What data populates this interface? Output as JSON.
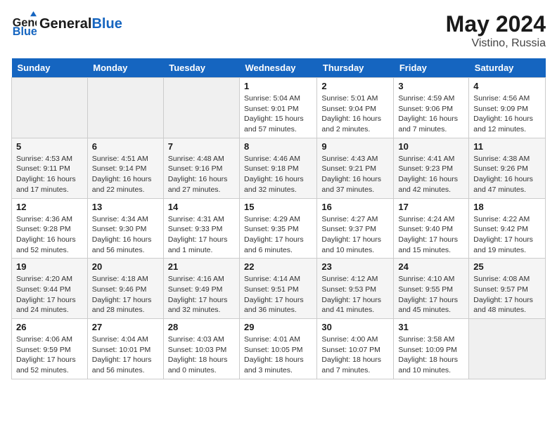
{
  "header": {
    "logo_general": "General",
    "logo_blue": "Blue",
    "month_year": "May 2024",
    "location": "Vistino, Russia"
  },
  "weekdays": [
    "Sunday",
    "Monday",
    "Tuesday",
    "Wednesday",
    "Thursday",
    "Friday",
    "Saturday"
  ],
  "weeks": [
    [
      {
        "day": "",
        "sunrise": "",
        "sunset": "",
        "daylight": ""
      },
      {
        "day": "",
        "sunrise": "",
        "sunset": "",
        "daylight": ""
      },
      {
        "day": "",
        "sunrise": "",
        "sunset": "",
        "daylight": ""
      },
      {
        "day": "1",
        "sunrise": "Sunrise: 5:04 AM",
        "sunset": "Sunset: 9:01 PM",
        "daylight": "Daylight: 15 hours and 57 minutes."
      },
      {
        "day": "2",
        "sunrise": "Sunrise: 5:01 AM",
        "sunset": "Sunset: 9:04 PM",
        "daylight": "Daylight: 16 hours and 2 minutes."
      },
      {
        "day": "3",
        "sunrise": "Sunrise: 4:59 AM",
        "sunset": "Sunset: 9:06 PM",
        "daylight": "Daylight: 16 hours and 7 minutes."
      },
      {
        "day": "4",
        "sunrise": "Sunrise: 4:56 AM",
        "sunset": "Sunset: 9:09 PM",
        "daylight": "Daylight: 16 hours and 12 minutes."
      }
    ],
    [
      {
        "day": "5",
        "sunrise": "Sunrise: 4:53 AM",
        "sunset": "Sunset: 9:11 PM",
        "daylight": "Daylight: 16 hours and 17 minutes."
      },
      {
        "day": "6",
        "sunrise": "Sunrise: 4:51 AM",
        "sunset": "Sunset: 9:14 PM",
        "daylight": "Daylight: 16 hours and 22 minutes."
      },
      {
        "day": "7",
        "sunrise": "Sunrise: 4:48 AM",
        "sunset": "Sunset: 9:16 PM",
        "daylight": "Daylight: 16 hours and 27 minutes."
      },
      {
        "day": "8",
        "sunrise": "Sunrise: 4:46 AM",
        "sunset": "Sunset: 9:18 PM",
        "daylight": "Daylight: 16 hours and 32 minutes."
      },
      {
        "day": "9",
        "sunrise": "Sunrise: 4:43 AM",
        "sunset": "Sunset: 9:21 PM",
        "daylight": "Daylight: 16 hours and 37 minutes."
      },
      {
        "day": "10",
        "sunrise": "Sunrise: 4:41 AM",
        "sunset": "Sunset: 9:23 PM",
        "daylight": "Daylight: 16 hours and 42 minutes."
      },
      {
        "day": "11",
        "sunrise": "Sunrise: 4:38 AM",
        "sunset": "Sunset: 9:26 PM",
        "daylight": "Daylight: 16 hours and 47 minutes."
      }
    ],
    [
      {
        "day": "12",
        "sunrise": "Sunrise: 4:36 AM",
        "sunset": "Sunset: 9:28 PM",
        "daylight": "Daylight: 16 hours and 52 minutes."
      },
      {
        "day": "13",
        "sunrise": "Sunrise: 4:34 AM",
        "sunset": "Sunset: 9:30 PM",
        "daylight": "Daylight: 16 hours and 56 minutes."
      },
      {
        "day": "14",
        "sunrise": "Sunrise: 4:31 AM",
        "sunset": "Sunset: 9:33 PM",
        "daylight": "Daylight: 17 hours and 1 minute."
      },
      {
        "day": "15",
        "sunrise": "Sunrise: 4:29 AM",
        "sunset": "Sunset: 9:35 PM",
        "daylight": "Daylight: 17 hours and 6 minutes."
      },
      {
        "day": "16",
        "sunrise": "Sunrise: 4:27 AM",
        "sunset": "Sunset: 9:37 PM",
        "daylight": "Daylight: 17 hours and 10 minutes."
      },
      {
        "day": "17",
        "sunrise": "Sunrise: 4:24 AM",
        "sunset": "Sunset: 9:40 PM",
        "daylight": "Daylight: 17 hours and 15 minutes."
      },
      {
        "day": "18",
        "sunrise": "Sunrise: 4:22 AM",
        "sunset": "Sunset: 9:42 PM",
        "daylight": "Daylight: 17 hours and 19 minutes."
      }
    ],
    [
      {
        "day": "19",
        "sunrise": "Sunrise: 4:20 AM",
        "sunset": "Sunset: 9:44 PM",
        "daylight": "Daylight: 17 hours and 24 minutes."
      },
      {
        "day": "20",
        "sunrise": "Sunrise: 4:18 AM",
        "sunset": "Sunset: 9:46 PM",
        "daylight": "Daylight: 17 hours and 28 minutes."
      },
      {
        "day": "21",
        "sunrise": "Sunrise: 4:16 AM",
        "sunset": "Sunset: 9:49 PM",
        "daylight": "Daylight: 17 hours and 32 minutes."
      },
      {
        "day": "22",
        "sunrise": "Sunrise: 4:14 AM",
        "sunset": "Sunset: 9:51 PM",
        "daylight": "Daylight: 17 hours and 36 minutes."
      },
      {
        "day": "23",
        "sunrise": "Sunrise: 4:12 AM",
        "sunset": "Sunset: 9:53 PM",
        "daylight": "Daylight: 17 hours and 41 minutes."
      },
      {
        "day": "24",
        "sunrise": "Sunrise: 4:10 AM",
        "sunset": "Sunset: 9:55 PM",
        "daylight": "Daylight: 17 hours and 45 minutes."
      },
      {
        "day": "25",
        "sunrise": "Sunrise: 4:08 AM",
        "sunset": "Sunset: 9:57 PM",
        "daylight": "Daylight: 17 hours and 48 minutes."
      }
    ],
    [
      {
        "day": "26",
        "sunrise": "Sunrise: 4:06 AM",
        "sunset": "Sunset: 9:59 PM",
        "daylight": "Daylight: 17 hours and 52 minutes."
      },
      {
        "day": "27",
        "sunrise": "Sunrise: 4:04 AM",
        "sunset": "Sunset: 10:01 PM",
        "daylight": "Daylight: 17 hours and 56 minutes."
      },
      {
        "day": "28",
        "sunrise": "Sunrise: 4:03 AM",
        "sunset": "Sunset: 10:03 PM",
        "daylight": "Daylight: 18 hours and 0 minutes."
      },
      {
        "day": "29",
        "sunrise": "Sunrise: 4:01 AM",
        "sunset": "Sunset: 10:05 PM",
        "daylight": "Daylight: 18 hours and 3 minutes."
      },
      {
        "day": "30",
        "sunrise": "Sunrise: 4:00 AM",
        "sunset": "Sunset: 10:07 PM",
        "daylight": "Daylight: 18 hours and 7 minutes."
      },
      {
        "day": "31",
        "sunrise": "Sunrise: 3:58 AM",
        "sunset": "Sunset: 10:09 PM",
        "daylight": "Daylight: 18 hours and 10 minutes."
      },
      {
        "day": "",
        "sunrise": "",
        "sunset": "",
        "daylight": ""
      }
    ]
  ]
}
